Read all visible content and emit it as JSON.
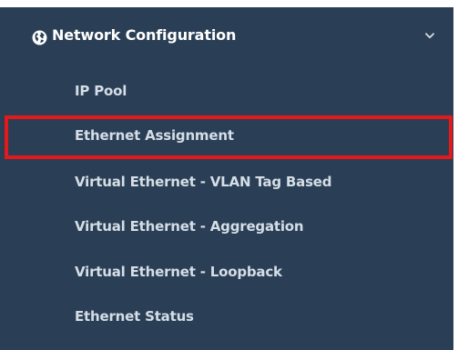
{
  "menu": {
    "header": {
      "label": "Network Configuration",
      "icon": "globe-icon",
      "toggle_icon": "chevron-down-icon"
    },
    "items": [
      {
        "label": "IP Pool"
      },
      {
        "label": "Ethernet Assignment",
        "highlighted": true
      },
      {
        "label": "Virtual Ethernet - VLAN Tag Based"
      },
      {
        "label": "Virtual Ethernet - Aggregation"
      },
      {
        "label": "Virtual Ethernet - Loopback"
      },
      {
        "label": "Ethernet Status"
      }
    ]
  },
  "colors": {
    "background": "#2a3e55",
    "text": "#d5dee6",
    "header_text": "#ffffff",
    "highlight_border": "#e4191b"
  }
}
